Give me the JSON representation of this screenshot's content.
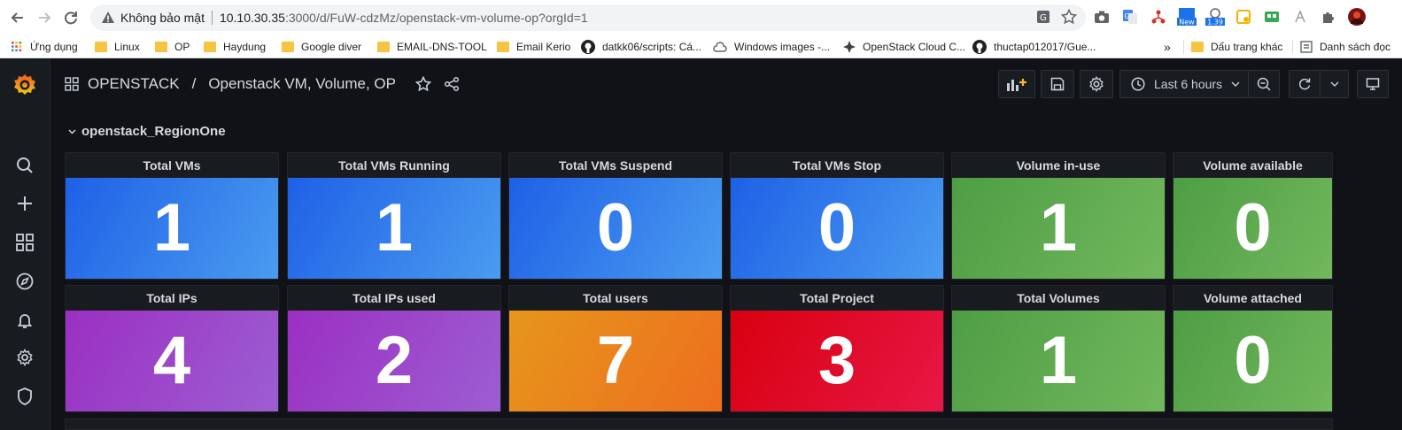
{
  "browser": {
    "security_text": "Không bảo mật",
    "url_host": "10.10.30.35",
    "url_rest": ":3000/d/FuW-cdzMz/openstack-vm-volume-op?orgId=1",
    "new_badge": "New",
    "ext_badge": "1.39",
    "bookmarks": [
      {
        "label": "Ứng dụng",
        "icon": "apps-grid-icon"
      },
      {
        "label": "Linux",
        "icon": "folder-icon"
      },
      {
        "label": "OP",
        "icon": "folder-icon"
      },
      {
        "label": "Haydung",
        "icon": "folder-icon"
      },
      {
        "label": "Google diver",
        "icon": "folder-icon"
      },
      {
        "label": "EMAIL-DNS-TOOL",
        "icon": "folder-icon"
      },
      {
        "label": "Email Kerio",
        "icon": "folder-icon"
      },
      {
        "label": "datkk06/scripts: Cá...",
        "icon": "github-icon"
      },
      {
        "label": "Windows images -...",
        "icon": "cloud-icon"
      },
      {
        "label": "OpenStack Cloud C...",
        "icon": "openstack-icon"
      },
      {
        "label": "thuctap012017/Gue...",
        "icon": "github-icon"
      }
    ],
    "overflow": "»",
    "other_bookmarks": "Dấu trang khác",
    "reading_list": "Danh sách đọc"
  },
  "dashboard": {
    "folder": "OPENSTACK",
    "separator": "/",
    "title": "Openstack VM, Volume, OP",
    "time_range": "Last 6 hours",
    "row_title": "openstack_RegionOne"
  },
  "panels": [
    {
      "title": "Total VMs",
      "value": "1",
      "color": "blue"
    },
    {
      "title": "Total VMs Running",
      "value": "1",
      "color": "blue"
    },
    {
      "title": "Total VMs Suspend",
      "value": "0",
      "color": "blue"
    },
    {
      "title": "Total VMs Stop",
      "value": "0",
      "color": "blue"
    },
    {
      "title": "Volume in-use",
      "value": "1",
      "color": "green"
    },
    {
      "title": "Volume available",
      "value": "0",
      "color": "green"
    },
    {
      "title": "Total IPs",
      "value": "4",
      "color": "purple"
    },
    {
      "title": "Total IPs used",
      "value": "2",
      "color": "purple"
    },
    {
      "title": "Total users",
      "value": "7",
      "color": "orange"
    },
    {
      "title": "Total Project",
      "value": "3",
      "color": "red"
    },
    {
      "title": "Total Volumes",
      "value": "1",
      "color": "green"
    },
    {
      "title": "Volume attached",
      "value": "0",
      "color": "green"
    }
  ],
  "colors": {
    "blue": [
      "#1f60e6",
      "#4a9cf0"
    ],
    "green": [
      "#4e9d45",
      "#72b85c"
    ],
    "purple": [
      "#9b2fc2",
      "#9c5ed2"
    ],
    "orange": [
      "#e6961b",
      "#ee6e1f"
    ],
    "red": [
      "#d8000f",
      "#e81746"
    ]
  }
}
